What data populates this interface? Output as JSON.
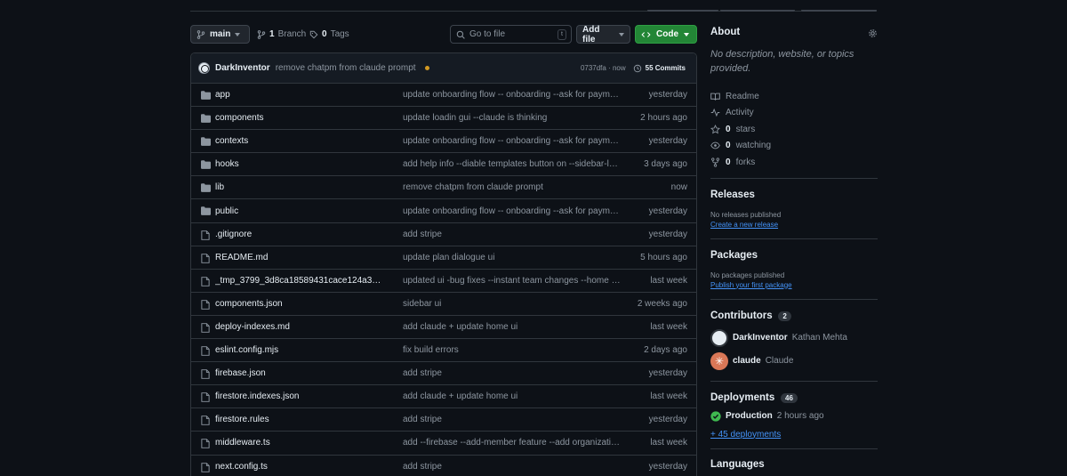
{
  "toolbar": {
    "branch": "main",
    "branch_count": "1",
    "branch_label": "Branch",
    "tag_count": "0",
    "tag_label": "Tags",
    "search_placeholder": "Go to file",
    "search_shortcut": "t",
    "add_file": "Add file",
    "code": "Code"
  },
  "commit": {
    "author": "DarkInventor",
    "message": "remove chatpm from claude prompt",
    "hash_time": "0737dfa · now",
    "commits": "55 Commits"
  },
  "files": [
    {
      "type": "dir",
      "name": "app",
      "message": "update onboarding flow -- onboarding --ask for payment ...",
      "date": "yesterday"
    },
    {
      "type": "dir",
      "name": "components",
      "message": "update loadin gui --claude is thinking",
      "date": "2 hours ago"
    },
    {
      "type": "dir",
      "name": "contexts",
      "message": "update onboarding flow -- onboarding --ask for payment ...",
      "date": "yesterday"
    },
    {
      "type": "dir",
      "name": "hooks",
      "message": "add help info --diable templates button on --sidebar-left ...",
      "date": "3 days ago"
    },
    {
      "type": "dir",
      "name": "lib",
      "message": "remove chatpm from claude prompt",
      "date": "now"
    },
    {
      "type": "dir",
      "name": "public",
      "message": "update onboarding flow -- onboarding --ask for payment ...",
      "date": "yesterday"
    },
    {
      "type": "file",
      "name": ".gitignore",
      "message": "add stripe",
      "date": "yesterday"
    },
    {
      "type": "file",
      "name": "README.md",
      "message": "update plan dialogue ui",
      "date": "5 hours ago"
    },
    {
      "type": "file",
      "name": "_tmp_3799_3d8ca18589431cace124a3190...",
      "message": "updated ui -bug fixes --instant team changes --home scr...",
      "date": "last week"
    },
    {
      "type": "file",
      "name": "components.json",
      "message": "sidebar ui",
      "date": "2 weeks ago"
    },
    {
      "type": "file",
      "name": "deploy-indexes.md",
      "message": "add claude + update home ui",
      "date": "last week"
    },
    {
      "type": "file",
      "name": "eslint.config.mjs",
      "message": "fix build errors",
      "date": "2 days ago"
    },
    {
      "type": "file",
      "name": "firebase.json",
      "message": "add stripe",
      "date": "yesterday"
    },
    {
      "type": "file",
      "name": "firestore.indexes.json",
      "message": "add claude + update home ui",
      "date": "last week"
    },
    {
      "type": "file",
      "name": "firestore.rules",
      "message": "add stripe",
      "date": "yesterday"
    },
    {
      "type": "file",
      "name": "middleware.ts",
      "message": "add --firebase --add-member feature --add organization ...",
      "date": "last week"
    },
    {
      "type": "file",
      "name": "next.config.ts",
      "message": "add stripe",
      "date": "yesterday"
    }
  ],
  "about": {
    "title": "About",
    "description": "No description, website, or topics provided.",
    "stats": [
      {
        "icon": "book-icon",
        "count": "",
        "label": "Readme"
      },
      {
        "icon": "pulse-icon",
        "count": "",
        "label": "Activity"
      },
      {
        "icon": "star-icon",
        "count": "0",
        "label": "stars"
      },
      {
        "icon": "eye-icon",
        "count": "0",
        "label": "watching"
      },
      {
        "icon": "fork-icon",
        "count": "0",
        "label": "forks"
      }
    ]
  },
  "releases": {
    "title": "Releases",
    "none": "No releases published",
    "link": "Create a new release"
  },
  "packages": {
    "title": "Packages",
    "none": "No packages published",
    "link": "Publish your first package"
  },
  "contributors": {
    "title": "Contributors",
    "count": "2",
    "list": [
      {
        "login": "DarkInventor",
        "name": "Kathan Mehta"
      },
      {
        "login": "claude",
        "name": "Claude"
      }
    ]
  },
  "deployments": {
    "title": "Deployments",
    "count": "46",
    "env": "Production",
    "time": "2 hours ago",
    "more": "+ 45 deployments"
  },
  "languages": {
    "title": "Languages"
  },
  "colors": {
    "accent": "#4493f8",
    "success": "#238636",
    "warning": "#d29922"
  }
}
